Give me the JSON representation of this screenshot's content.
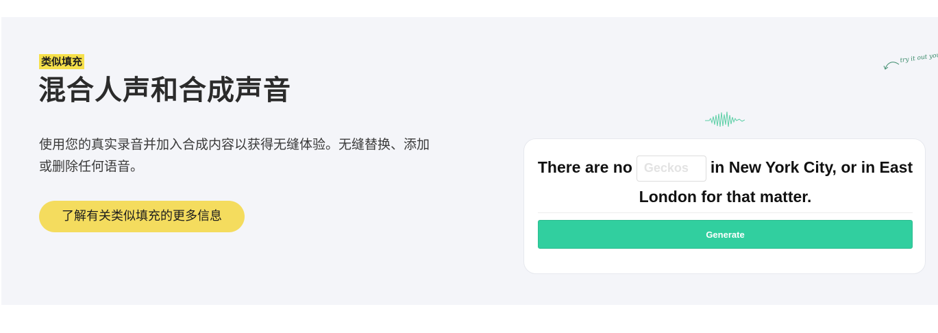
{
  "hero": {
    "tag": "类似填充",
    "title": "混合人声和合成声音",
    "description": "使用您的真实录音并加入合成内容以获得无缝体验。无缝替换、添加或删除任何语音。",
    "cta_label": "了解有关类似填充的更多信息"
  },
  "demo": {
    "annotation": "try it out yourself",
    "sentence_before": "There are no",
    "input_placeholder": "Geckos",
    "sentence_after": "in New York City, or in East London for that matter.",
    "generate_label": "Generate"
  },
  "colors": {
    "tag_bg": "#f6e04a",
    "cta_bg": "#f4dc5e",
    "generate_bg": "#31cf9f",
    "section_bg": "#f4f5f9"
  }
}
